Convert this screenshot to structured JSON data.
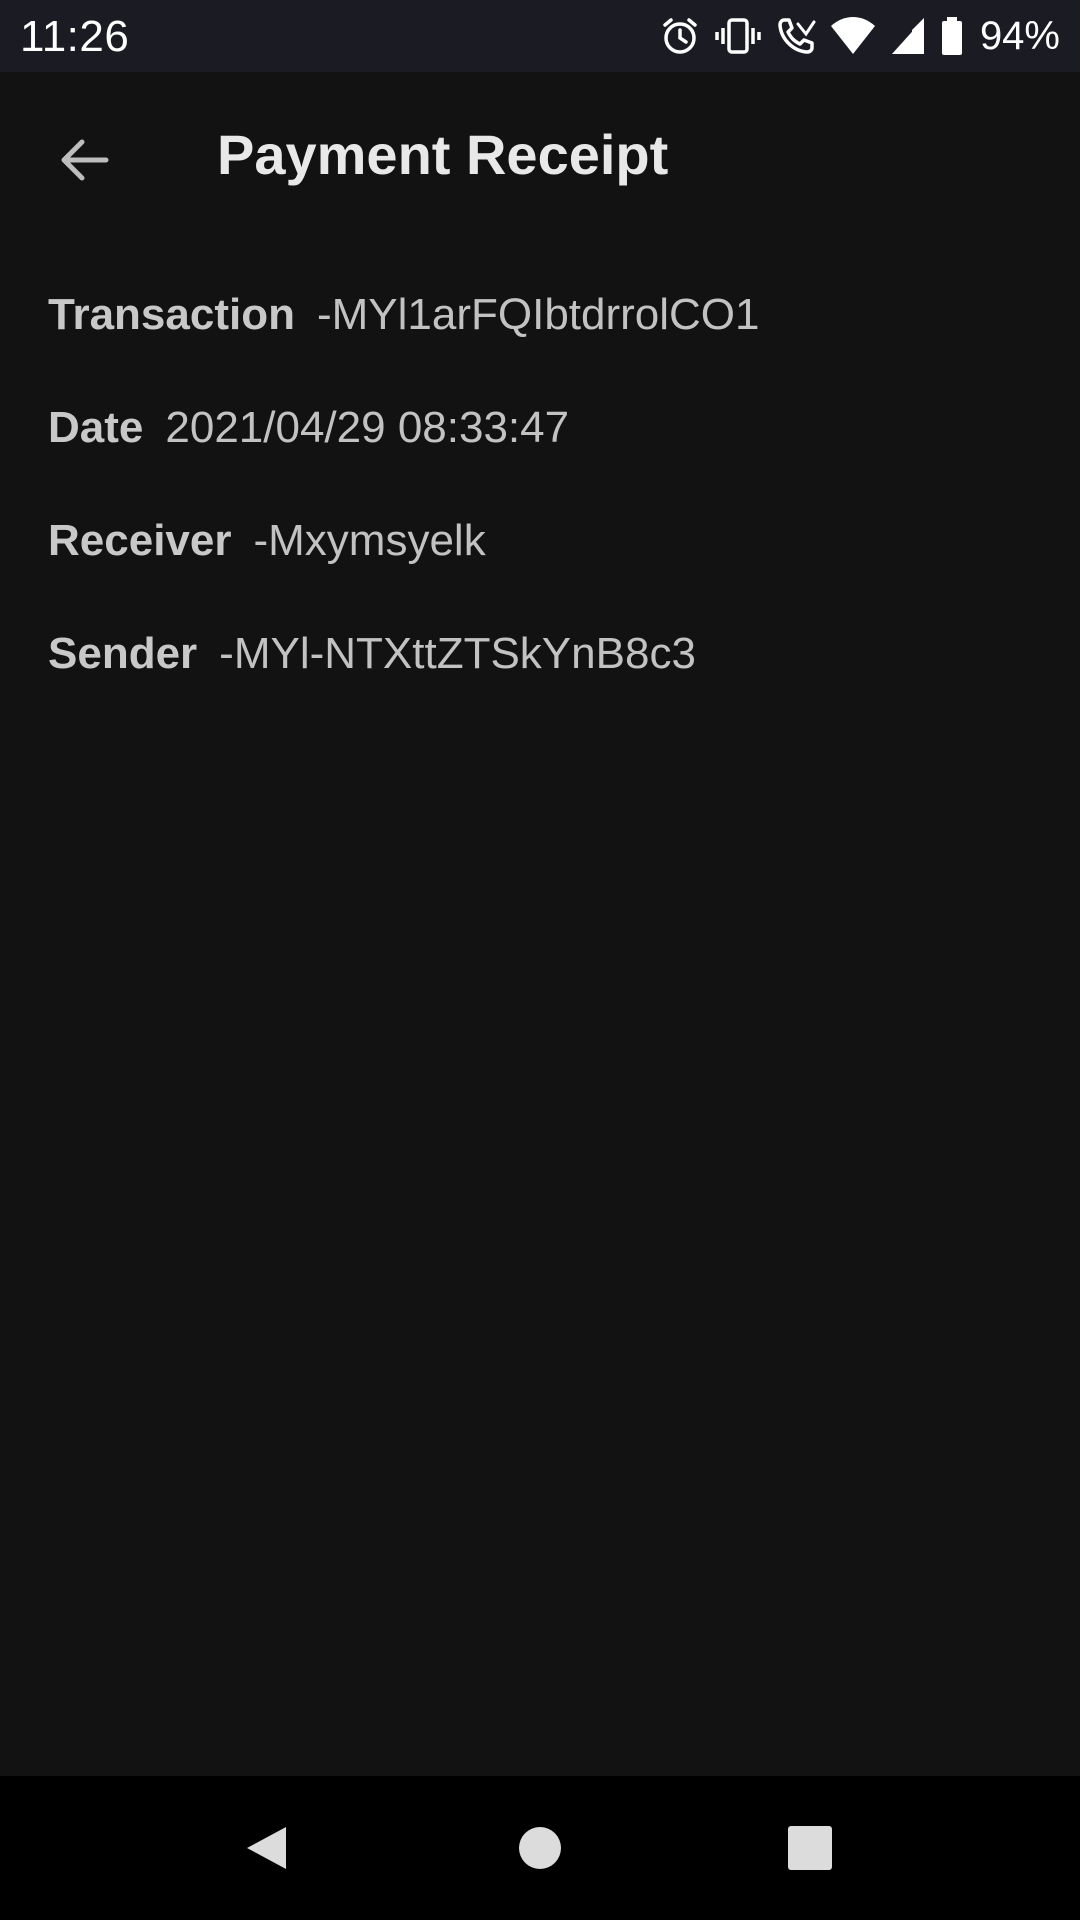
{
  "status_bar": {
    "time": "11:26",
    "battery_percent": "94%",
    "icons": [
      "alarm-icon",
      "vibrate-icon",
      "wifi-call-icon",
      "wifi-icon",
      "signal-icon",
      "battery-icon"
    ]
  },
  "app_bar": {
    "title": "Payment Receipt",
    "back_icon": "arrow-back-icon"
  },
  "receipt": {
    "transaction": {
      "label": "Transaction",
      "value": "-MYl1arFQIbtdrrolCO1"
    },
    "date": {
      "label": "Date",
      "value": "2021/04/29 08:33:47"
    },
    "receiver": {
      "label": "Receiver",
      "value": "-Mxymsyelk"
    },
    "sender": {
      "label": "Sender",
      "value": "-MYl-NTXttZTSkYnB8c3"
    }
  },
  "nav_bar": {
    "icons": [
      "nav-back-icon",
      "nav-home-icon",
      "nav-recents-icon"
    ]
  },
  "colors": {
    "background": "#121212",
    "status_bar": "#1b1b24",
    "nav_bar": "#000000",
    "title_text": "#e8e8e8",
    "body_text": "#c2c2c2"
  }
}
